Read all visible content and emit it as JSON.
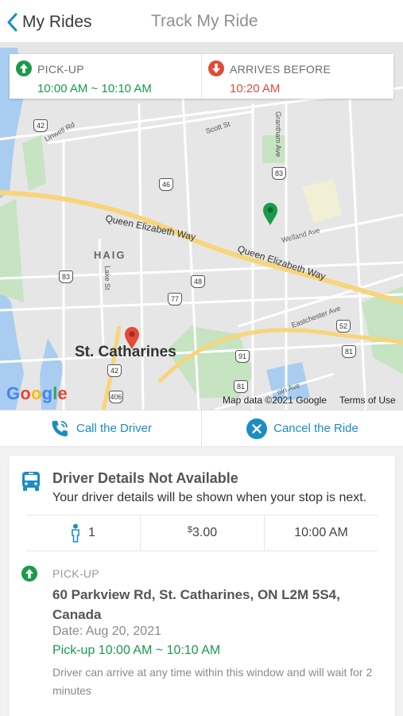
{
  "header": {
    "back_label": "My Rides",
    "title": "Track My Ride"
  },
  "times": {
    "pickup_label": "PICK-UP",
    "pickup_value": "10:00 AM ~ 10:10 AM",
    "arrives_label": "ARRIVES BEFORE",
    "arrives_value": "10:20 AM"
  },
  "map": {
    "labels": {
      "queen_elizabeth_1": "Queen Elizabeth Way",
      "queen_elizabeth_2": "Queen Elizabeth Way",
      "haig": "HAIG",
      "city": "St. Catharines",
      "scott_st": "Scott St",
      "linwell_rd": "Linwell Rd",
      "grantham_ave": "Grantham Ave",
      "welland_ave": "Welland Ave",
      "lake_st": "Lake St",
      "eastchester_ave": "Eastchester Ave",
      "lincoln_ave": "oln Ave"
    },
    "route_shields": [
      "42",
      "83",
      "46",
      "48",
      "77",
      "42",
      "83",
      "52",
      "81",
      "91",
      "406",
      "81"
    ],
    "logo": "Google",
    "attribution": "Map data ©2021 Google",
    "terms": "Terms of Use",
    "marker_colors": {
      "pickup": "#1a9a4a",
      "dropoff": "#e24a3a"
    }
  },
  "actions": {
    "call_label": "Call the Driver",
    "cancel_label": "Cancel the Ride"
  },
  "driver": {
    "title": "Driver Details Not Available",
    "subtitle": "Your driver details will be shown when your stop is next.",
    "passengers": "1",
    "fare_currency": "$",
    "fare_amount": "3.00",
    "time": "10:00 AM"
  },
  "pickup": {
    "label": "PICK-UP",
    "address": "60 Parkview Rd, St. Catharines, ON L2M 5S4, Canada",
    "date": "Date: Aug 20, 2021",
    "window": "Pick-up 10:00 AM ~ 10:10 AM",
    "note": "Driver can arrive at any time within this window and will wait for 2 minutes"
  },
  "colors": {
    "accent": "#1b8dc3",
    "green": "#1a9a4a",
    "red": "#e24a3a"
  }
}
